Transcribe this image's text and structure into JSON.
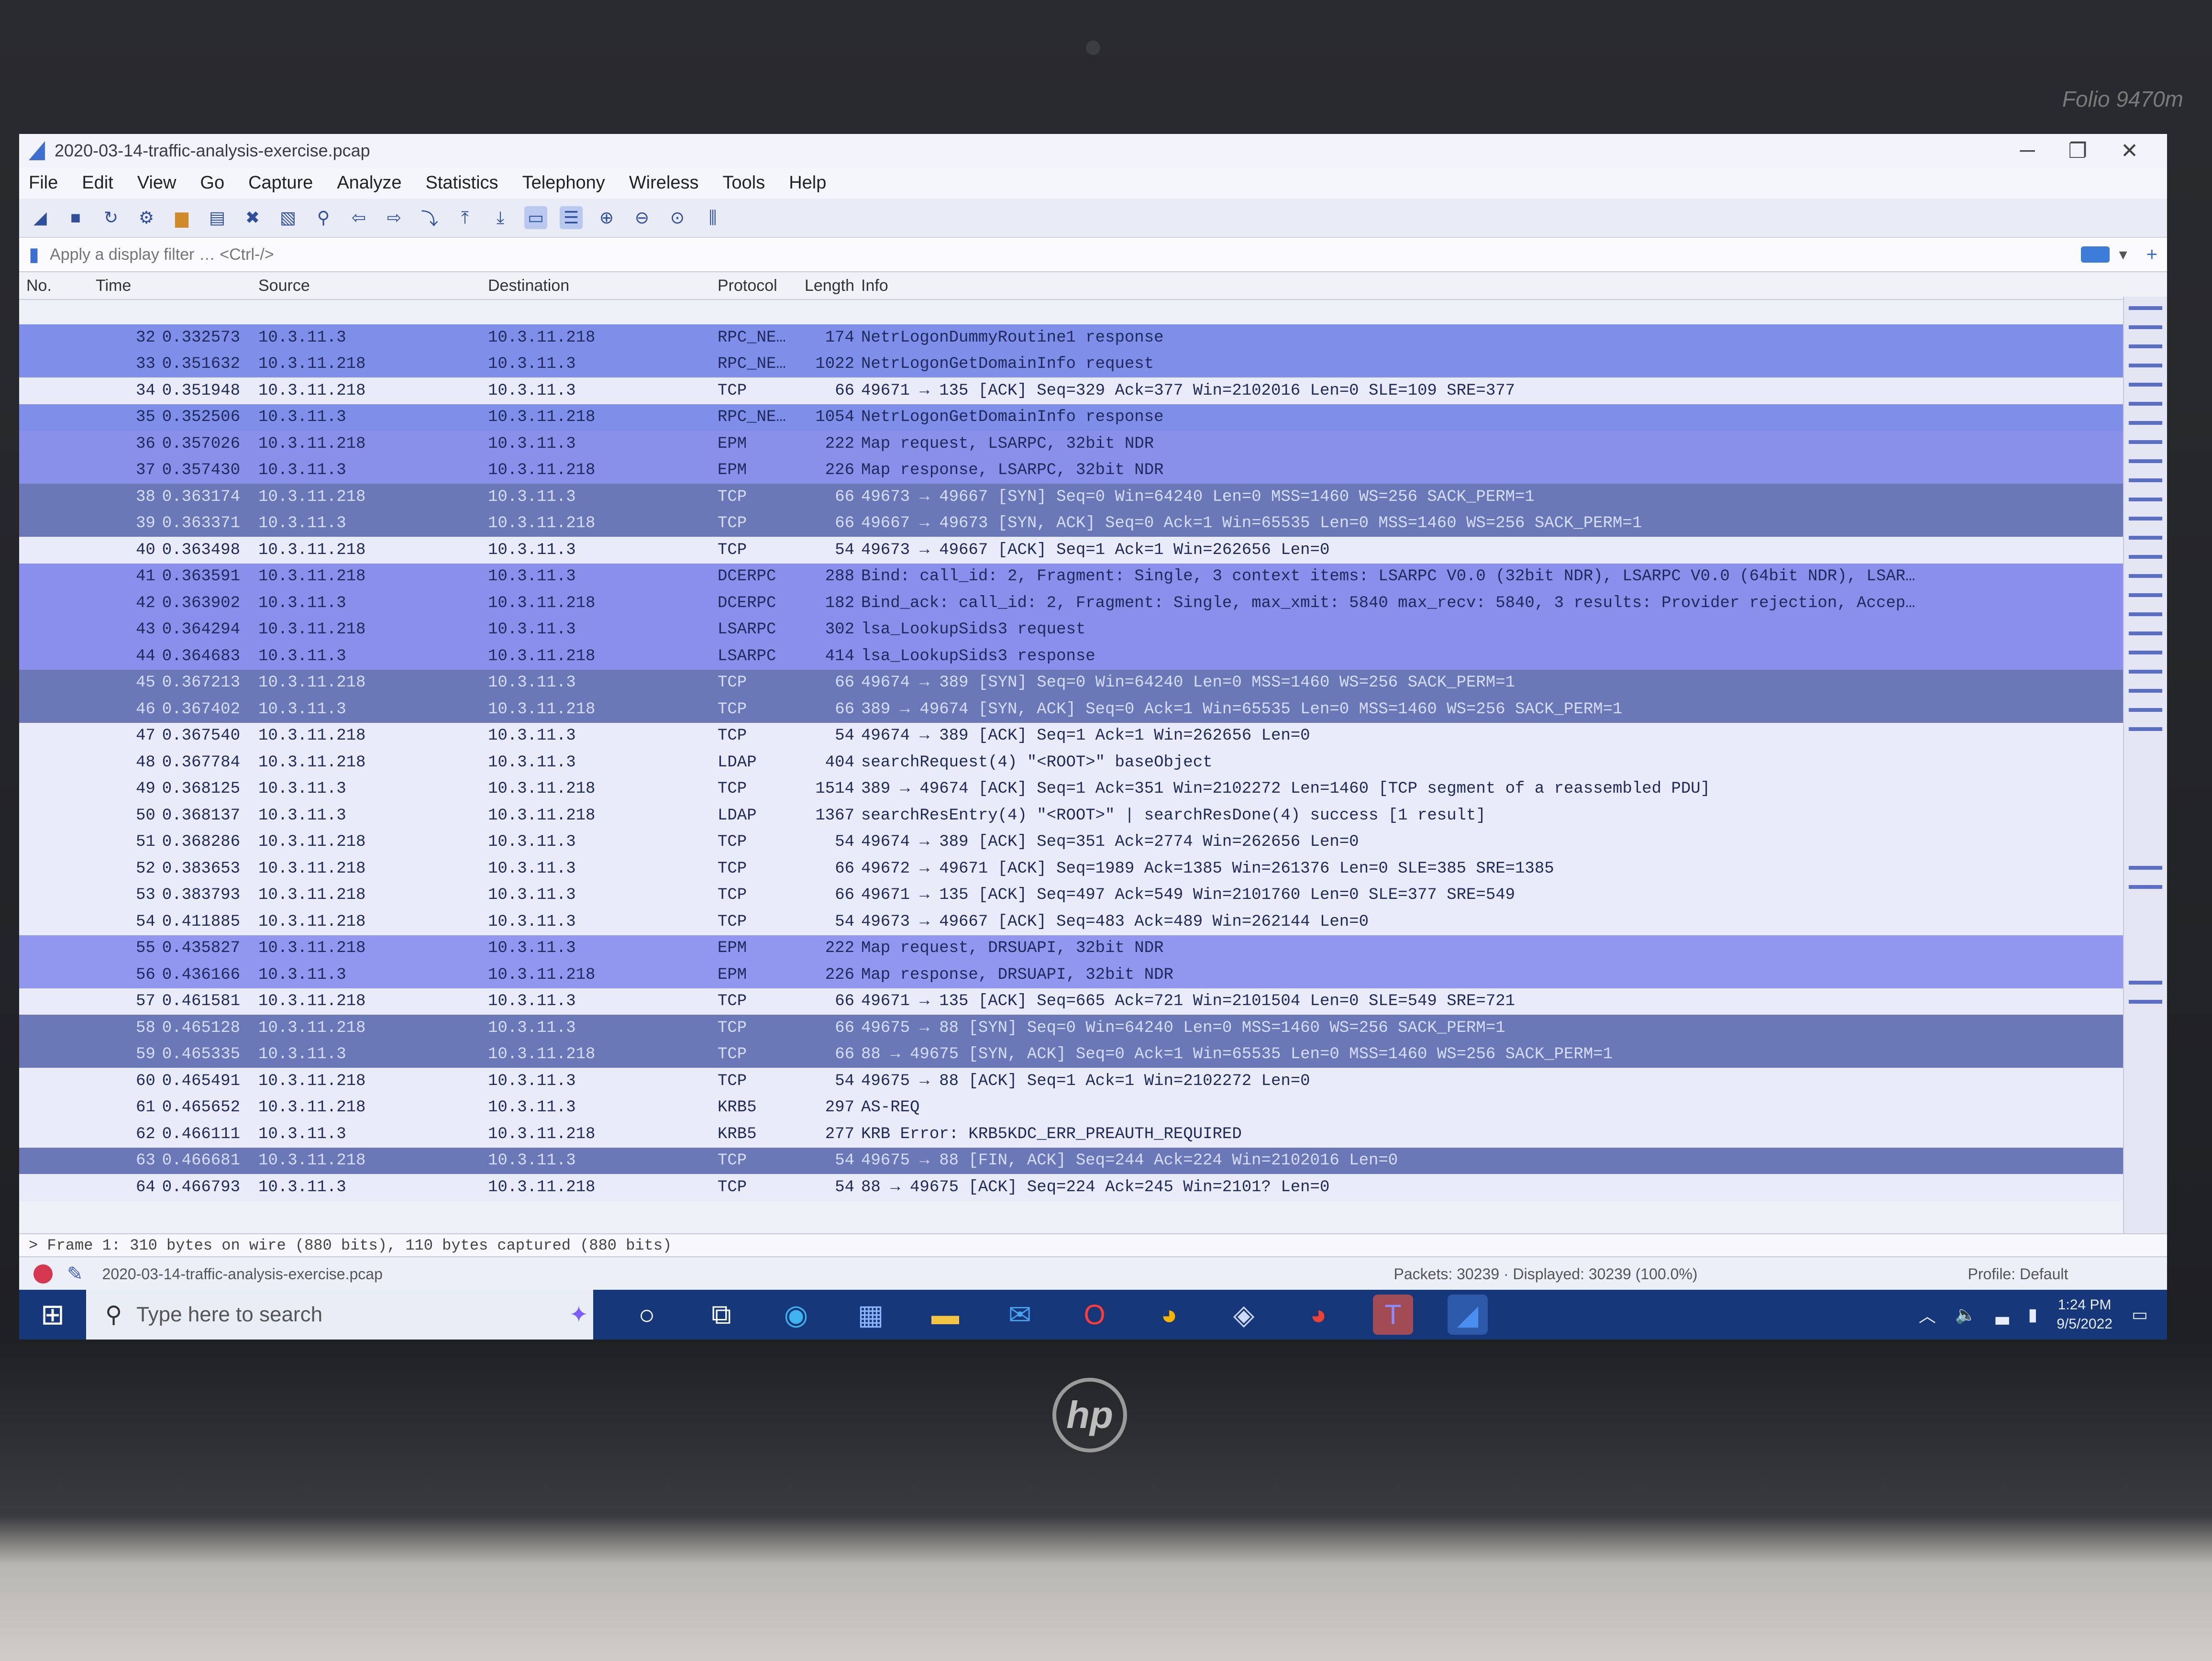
{
  "device": {
    "model_label": "Folio 9470m",
    "brand_logo": "hp"
  },
  "window": {
    "title": "2020-03-14-traffic-analysis-exercise.pcap",
    "controls": [
      "─",
      "❐",
      "✕"
    ]
  },
  "menu": [
    "File",
    "Edit",
    "View",
    "Go",
    "Capture",
    "Analyze",
    "Statistics",
    "Telephony",
    "Wireless",
    "Tools",
    "Help"
  ],
  "filter": {
    "placeholder": "Apply a display filter … <Ctrl-/>",
    "add_button": "+"
  },
  "columns": {
    "no": "No.",
    "time": "Time",
    "source": "Source",
    "destination": "Destination",
    "protocol": "Protocol",
    "length": "Length",
    "info": "Info"
  },
  "colors": {
    "rpc": "#7f8ee8",
    "tcp_white": "#e9ebf8",
    "tcp_dark": "#6f7fc0",
    "epm": "#8f95ea",
    "dcerpc": "#8c92ec",
    "lsarpc": "#8f93ee",
    "ldap": "#e9ebf8",
    "krb": "#e9ebf8"
  },
  "packets": [
    {
      "no": "32",
      "time": "0.332573",
      "src": "10.3.11.3",
      "dst": "10.3.11.218",
      "proto": "RPC_NE…",
      "len": "174",
      "info": "NetrLogonDummyRoutine1 response",
      "bg": "#7f8ee8"
    },
    {
      "no": "33",
      "time": "0.351632",
      "src": "10.3.11.218",
      "dst": "10.3.11.3",
      "proto": "RPC_NE…",
      "len": "1022",
      "info": "NetrLogonGetDomainInfo request",
      "bg": "#7f8ee8"
    },
    {
      "no": "34",
      "time": "0.351948",
      "src": "10.3.11.218",
      "dst": "10.3.11.3",
      "proto": "TCP",
      "len": "66",
      "info": "49671 → 135 [ACK] Seq=329 Ack=377 Win=2102016 Len=0 SLE=109 SRE=377",
      "bg": "#e9ebf8"
    },
    {
      "no": "35",
      "time": "0.352506",
      "src": "10.3.11.3",
      "dst": "10.3.11.218",
      "proto": "RPC_NE…",
      "len": "1054",
      "info": "NetrLogonGetDomainInfo response",
      "bg": "#7f8ee8"
    },
    {
      "no": "36",
      "time": "0.357026",
      "src": "10.3.11.218",
      "dst": "10.3.11.3",
      "proto": "EPM",
      "len": "222",
      "info": "Map request, LSARPC, 32bit NDR",
      "bg": "#8890ea"
    },
    {
      "no": "37",
      "time": "0.357430",
      "src": "10.3.11.3",
      "dst": "10.3.11.218",
      "proto": "EPM",
      "len": "226",
      "info": "Map response, LSARPC, 32bit NDR",
      "bg": "#8890ea"
    },
    {
      "no": "38",
      "time": "0.363174",
      "src": "10.3.11.218",
      "dst": "10.3.11.3",
      "proto": "TCP",
      "len": "66",
      "info": "49673 → 49667 [SYN] Seq=0 Win=64240 Len=0 MSS=1460 WS=256 SACK_PERM=1",
      "bg": "#6b78b8"
    },
    {
      "no": "39",
      "time": "0.363371",
      "src": "10.3.11.3",
      "dst": "10.3.11.218",
      "proto": "TCP",
      "len": "66",
      "info": "49667 → 49673 [SYN, ACK] Seq=0 Ack=1 Win=65535 Len=0 MSS=1460 WS=256 SACK_PERM=1",
      "bg": "#6b78b8"
    },
    {
      "no": "40",
      "time": "0.363498",
      "src": "10.3.11.218",
      "dst": "10.3.11.3",
      "proto": "TCP",
      "len": "54",
      "info": "49673 → 49667 [ACK] Seq=1 Ack=1 Win=262656 Len=0",
      "bg": "#e9ebf8"
    },
    {
      "no": "41",
      "time": "0.363591",
      "src": "10.3.11.218",
      "dst": "10.3.11.3",
      "proto": "DCERPC",
      "len": "288",
      "info": "Bind: call_id: 2, Fragment: Single, 3 context items: LSARPC V0.0 (32bit NDR), LSARPC V0.0 (64bit NDR), LSAR…",
      "bg": "#8a8fec"
    },
    {
      "no": "42",
      "time": "0.363902",
      "src": "10.3.11.3",
      "dst": "10.3.11.218",
      "proto": "DCERPC",
      "len": "182",
      "info": "Bind_ack: call_id: 2, Fragment: Single, max_xmit: 5840 max_recv: 5840, 3 results: Provider rejection, Accep…",
      "bg": "#8a8fec"
    },
    {
      "no": "43",
      "time": "0.364294",
      "src": "10.3.11.218",
      "dst": "10.3.11.3",
      "proto": "LSARPC",
      "len": "302",
      "info": "lsa_LookupSids3 request",
      "bg": "#8a8fec"
    },
    {
      "no": "44",
      "time": "0.364683",
      "src": "10.3.11.3",
      "dst": "10.3.11.218",
      "proto": "LSARPC",
      "len": "414",
      "info": "lsa_LookupSids3 response",
      "bg": "#8a8fec"
    },
    {
      "no": "45",
      "time": "0.367213",
      "src": "10.3.11.218",
      "dst": "10.3.11.3",
      "proto": "TCP",
      "len": "66",
      "info": "49674 → 389 [SYN] Seq=0 Win=64240 Len=0 MSS=1460 WS=256 SACK_PERM=1",
      "bg": "#6b78b8"
    },
    {
      "no": "46",
      "time": "0.367402",
      "src": "10.3.11.3",
      "dst": "10.3.11.218",
      "proto": "TCP",
      "len": "66",
      "info": "389 → 49674 [SYN, ACK] Seq=0 Ack=1 Win=65535 Len=0 MSS=1460 WS=256 SACK_PERM=1",
      "bg": "#6b78b8"
    },
    {
      "no": "47",
      "time": "0.367540",
      "src": "10.3.11.218",
      "dst": "10.3.11.3",
      "proto": "TCP",
      "len": "54",
      "info": "49674 → 389 [ACK] Seq=1 Ack=1 Win=262656 Len=0",
      "bg": "#e9ebf8"
    },
    {
      "no": "48",
      "time": "0.367784",
      "src": "10.3.11.218",
      "dst": "10.3.11.3",
      "proto": "LDAP",
      "len": "404",
      "info": "searchRequest(4) \"<ROOT>\" baseObject",
      "bg": "#e9ebf8"
    },
    {
      "no": "49",
      "time": "0.368125",
      "src": "10.3.11.3",
      "dst": "10.3.11.218",
      "proto": "TCP",
      "len": "1514",
      "info": "389 → 49674 [ACK] Seq=1 Ack=351 Win=2102272 Len=1460 [TCP segment of a reassembled PDU]",
      "bg": "#e9ebf8"
    },
    {
      "no": "50",
      "time": "0.368137",
      "src": "10.3.11.3",
      "dst": "10.3.11.218",
      "proto": "LDAP",
      "len": "1367",
      "info": "searchResEntry(4) \"<ROOT>\" | searchResDone(4) success [1 result]",
      "bg": "#e9ebf8"
    },
    {
      "no": "51",
      "time": "0.368286",
      "src": "10.3.11.218",
      "dst": "10.3.11.3",
      "proto": "TCP",
      "len": "54",
      "info": "49674 → 389 [ACK] Seq=351 Ack=2774 Win=262656 Len=0",
      "bg": "#e9ebf8"
    },
    {
      "no": "52",
      "time": "0.383653",
      "src": "10.3.11.218",
      "dst": "10.3.11.3",
      "proto": "TCP",
      "len": "66",
      "info": "49672 → 49671 [ACK] Seq=1989 Ack=1385 Win=261376 Len=0 SLE=385 SRE=1385",
      "bg": "#e9ebf8"
    },
    {
      "no": "53",
      "time": "0.383793",
      "src": "10.3.11.218",
      "dst": "10.3.11.3",
      "proto": "TCP",
      "len": "66",
      "info": "49671 → 135 [ACK] Seq=497 Ack=549 Win=2101760 Len=0 SLE=377 SRE=549",
      "bg": "#e9ebf8"
    },
    {
      "no": "54",
      "time": "0.411885",
      "src": "10.3.11.218",
      "dst": "10.3.11.3",
      "proto": "TCP",
      "len": "54",
      "info": "49673 → 49667 [ACK] Seq=483 Ack=489 Win=262144 Len=0",
      "bg": "#e9ebf8"
    },
    {
      "no": "55",
      "time": "0.435827",
      "src": "10.3.11.218",
      "dst": "10.3.11.3",
      "proto": "EPM",
      "len": "222",
      "info": "Map request, DRSUAPI, 32bit NDR",
      "bg": "#9196ee"
    },
    {
      "no": "56",
      "time": "0.436166",
      "src": "10.3.11.3",
      "dst": "10.3.11.218",
      "proto": "EPM",
      "len": "226",
      "info": "Map response, DRSUAPI, 32bit NDR",
      "bg": "#9196ee"
    },
    {
      "no": "57",
      "time": "0.461581",
      "src": "10.3.11.218",
      "dst": "10.3.11.3",
      "proto": "TCP",
      "len": "66",
      "info": "49671 → 135 [ACK] Seq=665 Ack=721 Win=2101504 Len=0 SLE=549 SRE=721",
      "bg": "#e9ebf8"
    },
    {
      "no": "58",
      "time": "0.465128",
      "src": "10.3.11.218",
      "dst": "10.3.11.3",
      "proto": "TCP",
      "len": "66",
      "info": "49675 → 88 [SYN] Seq=0 Win=64240 Len=0 MSS=1460 WS=256 SACK_PERM=1",
      "bg": "#6b78b8"
    },
    {
      "no": "59",
      "time": "0.465335",
      "src": "10.3.11.3",
      "dst": "10.3.11.218",
      "proto": "TCP",
      "len": "66",
      "info": "88 → 49675 [SYN, ACK] Seq=0 Ack=1 Win=65535 Len=0 MSS=1460 WS=256 SACK_PERM=1",
      "bg": "#6b78b8"
    },
    {
      "no": "60",
      "time": "0.465491",
      "src": "10.3.11.218",
      "dst": "10.3.11.3",
      "proto": "TCP",
      "len": "54",
      "info": "49675 → 88 [ACK] Seq=1 Ack=1 Win=2102272 Len=0",
      "bg": "#e9ebf8"
    },
    {
      "no": "61",
      "time": "0.465652",
      "src": "10.3.11.218",
      "dst": "10.3.11.3",
      "proto": "KRB5",
      "len": "297",
      "info": "AS-REQ",
      "bg": "#e9ebf8"
    },
    {
      "no": "62",
      "time": "0.466111",
      "src": "10.3.11.3",
      "dst": "10.3.11.218",
      "proto": "KRB5",
      "len": "277",
      "info": "KRB Error: KRB5KDC_ERR_PREAUTH_REQUIRED",
      "bg": "#e9ebf8"
    },
    {
      "no": "63",
      "time": "0.466681",
      "src": "10.3.11.218",
      "dst": "10.3.11.3",
      "proto": "TCP",
      "len": "54",
      "info": "49675 → 88 [FIN, ACK] Seq=244 Ack=224 Win=2102016 Len=0",
      "bg": "#6b78b8"
    },
    {
      "no": "64",
      "time": "0.466793",
      "src": "10.3.11.3",
      "dst": "10.3.11.218",
      "proto": "TCP",
      "len": "54",
      "info": "88 → 49675 [ACK] Seq=224 Ack=245 Win=2101? Len=0",
      "bg": "#e9ebf8"
    }
  ],
  "details": "> Frame 1: 310 bytes on wire (880 bits), 110 bytes captured (880 bits)",
  "status": {
    "file": "2020-03-14-traffic-analysis-exercise.pcap",
    "counts": "Packets: 30239 · Displayed: 30239 (100.0%)",
    "profile": "Profile: Default"
  },
  "taskbar": {
    "search_placeholder": "Type here to search",
    "icons": [
      "cortana-icon",
      "task-view-icon",
      "edge-icon",
      "store-icon",
      "file-explorer-icon",
      "mail-icon",
      "opera-icon",
      "chrome-icon",
      "app-icon",
      "chrome-alt-icon",
      "teams-icon",
      "wireshark-icon"
    ],
    "time": "1:24 PM",
    "date": "9/5/2022"
  }
}
